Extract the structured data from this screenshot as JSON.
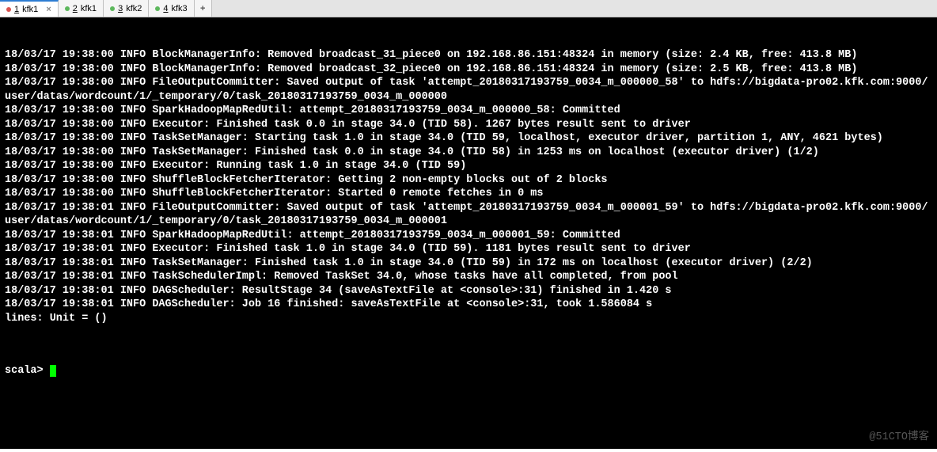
{
  "tabs": [
    {
      "num": "1",
      "label": "kfk1",
      "dot": "red",
      "active": true
    },
    {
      "num": "2",
      "label": "kfk1",
      "dot": "green",
      "active": false
    },
    {
      "num": "3",
      "label": "kfk2",
      "dot": "green",
      "active": false
    },
    {
      "num": "4",
      "label": "kfk3",
      "dot": "green",
      "active": false
    }
  ],
  "new_tab": "+",
  "close_glyph": "×",
  "lines": [
    "18/03/17 19:38:00 INFO BlockManagerInfo: Removed broadcast_31_piece0 on 192.168.86.151:48324 in memory (size: 2.4 KB, free: 413.8 MB)",
    "18/03/17 19:38:00 INFO BlockManagerInfo: Removed broadcast_32_piece0 on 192.168.86.151:48324 in memory (size: 2.5 KB, free: 413.8 MB)",
    "18/03/17 19:38:00 INFO FileOutputCommitter: Saved output of task 'attempt_20180317193759_0034_m_000000_58' to hdfs://bigdata-pro02.kfk.com:9000/user/datas/wordcount/1/_temporary/0/task_20180317193759_0034_m_000000",
    "18/03/17 19:38:00 INFO SparkHadoopMapRedUtil: attempt_20180317193759_0034_m_000000_58: Committed",
    "18/03/17 19:38:00 INFO Executor: Finished task 0.0 in stage 34.0 (TID 58). 1267 bytes result sent to driver",
    "18/03/17 19:38:00 INFO TaskSetManager: Starting task 1.0 in stage 34.0 (TID 59, localhost, executor driver, partition 1, ANY, 4621 bytes)",
    "18/03/17 19:38:00 INFO TaskSetManager: Finished task 0.0 in stage 34.0 (TID 58) in 1253 ms on localhost (executor driver) (1/2)",
    "18/03/17 19:38:00 INFO Executor: Running task 1.0 in stage 34.0 (TID 59)",
    "18/03/17 19:38:00 INFO ShuffleBlockFetcherIterator: Getting 2 non-empty blocks out of 2 blocks",
    "18/03/17 19:38:00 INFO ShuffleBlockFetcherIterator: Started 0 remote fetches in 0 ms",
    "18/03/17 19:38:01 INFO FileOutputCommitter: Saved output of task 'attempt_20180317193759_0034_m_000001_59' to hdfs://bigdata-pro02.kfk.com:9000/user/datas/wordcount/1/_temporary/0/task_20180317193759_0034_m_000001",
    "18/03/17 19:38:01 INFO SparkHadoopMapRedUtil: attempt_20180317193759_0034_m_000001_59: Committed",
    "18/03/17 19:38:01 INFO Executor: Finished task 1.0 in stage 34.0 (TID 59). 1181 bytes result sent to driver",
    "18/03/17 19:38:01 INFO TaskSetManager: Finished task 1.0 in stage 34.0 (TID 59) in 172 ms on localhost (executor driver) (2/2)",
    "18/03/17 19:38:01 INFO TaskSchedulerImpl: Removed TaskSet 34.0, whose tasks have all completed, from pool",
    "18/03/17 19:38:01 INFO DAGScheduler: ResultStage 34 (saveAsTextFile at <console>:31) finished in 1.420 s",
    "18/03/17 19:38:01 INFO DAGScheduler: Job 16 finished: saveAsTextFile at <console>:31, took 1.586084 s",
    "lines: Unit = ()"
  ],
  "prompt": "scala> ",
  "watermark": "@51CTO博客"
}
